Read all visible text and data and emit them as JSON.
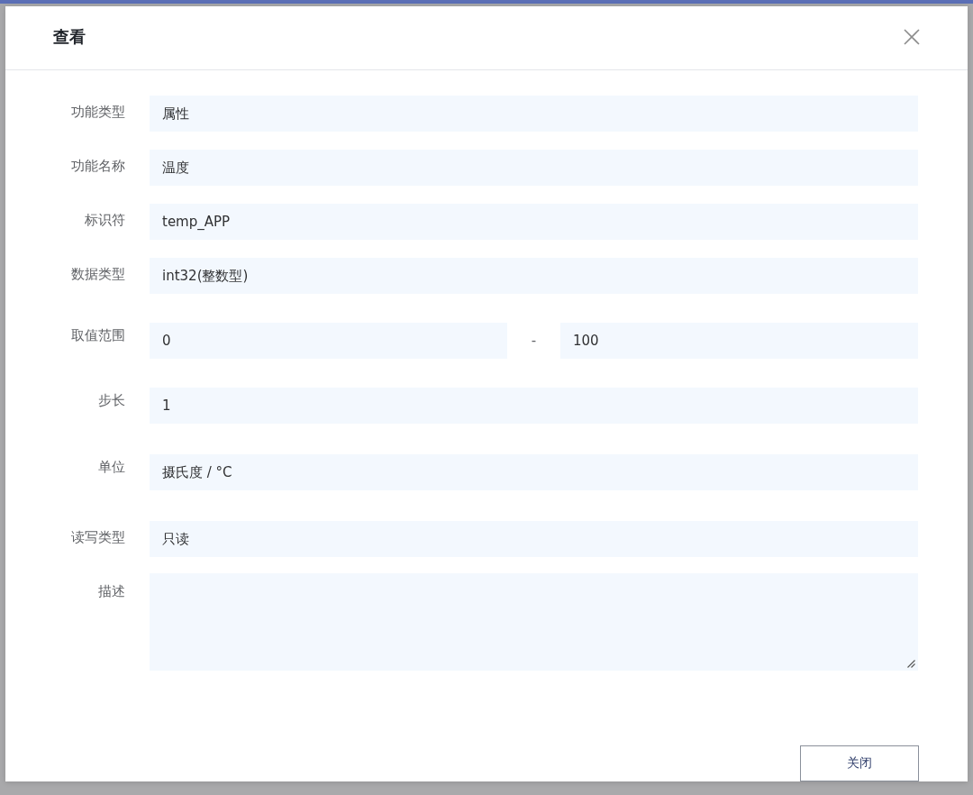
{
  "dialog": {
    "title": "查看"
  },
  "fields": [
    {
      "kind": "text",
      "label": "功能类型",
      "value": "属性"
    },
    {
      "kind": "text",
      "label": "功能名称",
      "value": "温度"
    },
    {
      "kind": "text",
      "label": "标识符",
      "value": "temp_APP"
    },
    {
      "kind": "text",
      "label": "数据类型",
      "value": "int32(整数型)"
    },
    {
      "kind": "range",
      "label": "取值范围",
      "min": "0",
      "separator": "-",
      "max": "100"
    },
    {
      "kind": "text",
      "label": "步长",
      "value": "1"
    },
    {
      "kind": "text",
      "label": "单位",
      "value": "摄氏度 / °C"
    },
    {
      "kind": "text",
      "label": "读写类型",
      "value": "只读"
    },
    {
      "kind": "textarea",
      "label": "描述"
    }
  ],
  "buttons": [
    {
      "label": "关闭"
    }
  ]
}
